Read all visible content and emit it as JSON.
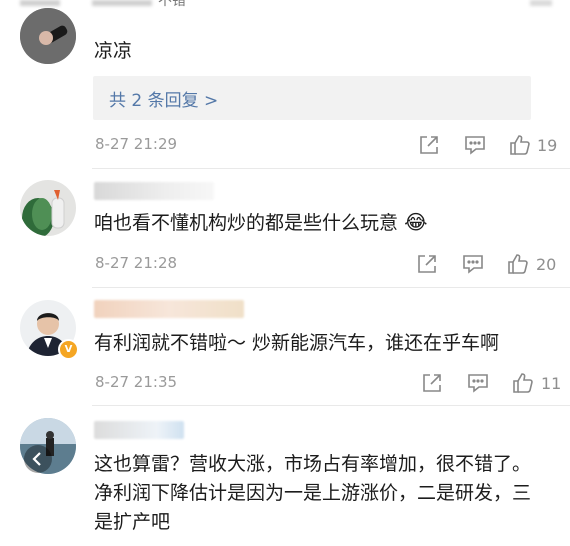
{
  "top_partial": {
    "fragment": "不错"
  },
  "comments": [
    {
      "text": "凉凉",
      "replies_label": "共 2 条回复 >",
      "time": "8-27 21:29",
      "likes": "19"
    },
    {
      "text": "咱也看不懂机构炒的都是些什么玩意",
      "emoji": "😂",
      "time": "8-27 21:28",
      "likes": "20"
    },
    {
      "text": "有利润就不错啦～ 炒新能源汽车，谁还在乎车啊",
      "badge": "V",
      "time": "8-27 21:35",
      "likes": "11"
    },
    {
      "text": "这也算雷？营收大涨，市场占有率增加，很不错了。净利润下降估计是因为一是上游涨价，二是研发，三是扩产吧"
    }
  ],
  "icons": {
    "share": "share-icon",
    "comment": "comment-icon",
    "like": "thumbs-up-icon"
  },
  "colors": {
    "link": "#5478a8",
    "meta": "#9a9a9a",
    "badge": "#f5a623"
  }
}
